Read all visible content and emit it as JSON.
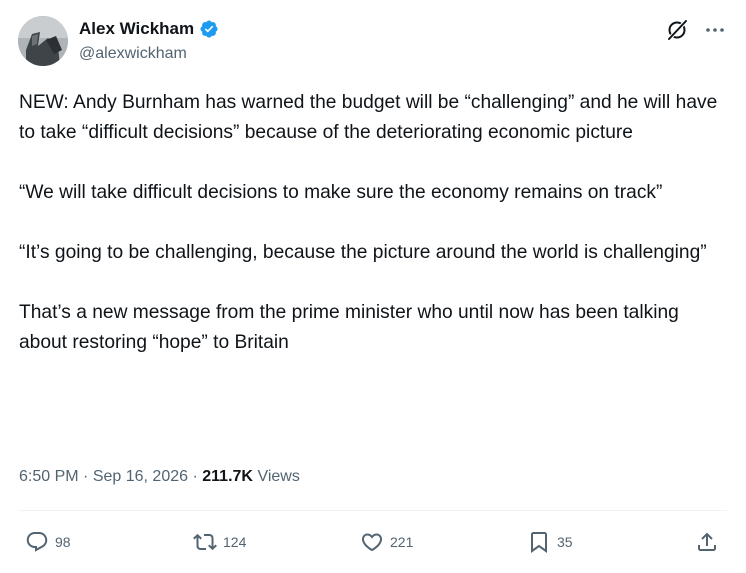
{
  "author": {
    "name": "Alex Wickham",
    "handle": "@alexwickham",
    "avatar_icon": "profile-photo"
  },
  "header_icons": [
    "grok-icon",
    "more-options-icon"
  ],
  "tweet": {
    "paragraphs": [
      "NEW: Andy Burnham has warned the budget will be “challenging” and he will have to take “difficult decisions” because of the deteriorating economic picture",
      "“We will take difficult decisions to make sure the economy remains on track”",
      "“It’s going to be challenging, because the picture around the world is challenging”",
      "That’s a new message from the prime minister who until now has been talking about restoring “hope” to Britain"
    ]
  },
  "meta": {
    "time": "6:50 PM",
    "date": "Sep 16, 2026",
    "views_count": "211.7K",
    "views_label": "Views"
  },
  "actions": {
    "replies": "98",
    "reposts": "124",
    "likes": "221",
    "bookmarks": "35"
  },
  "colors": {
    "text": "#0f1419",
    "secondary": "#536471",
    "verified": "#1d9bf0",
    "divider": "#eff3f4"
  }
}
